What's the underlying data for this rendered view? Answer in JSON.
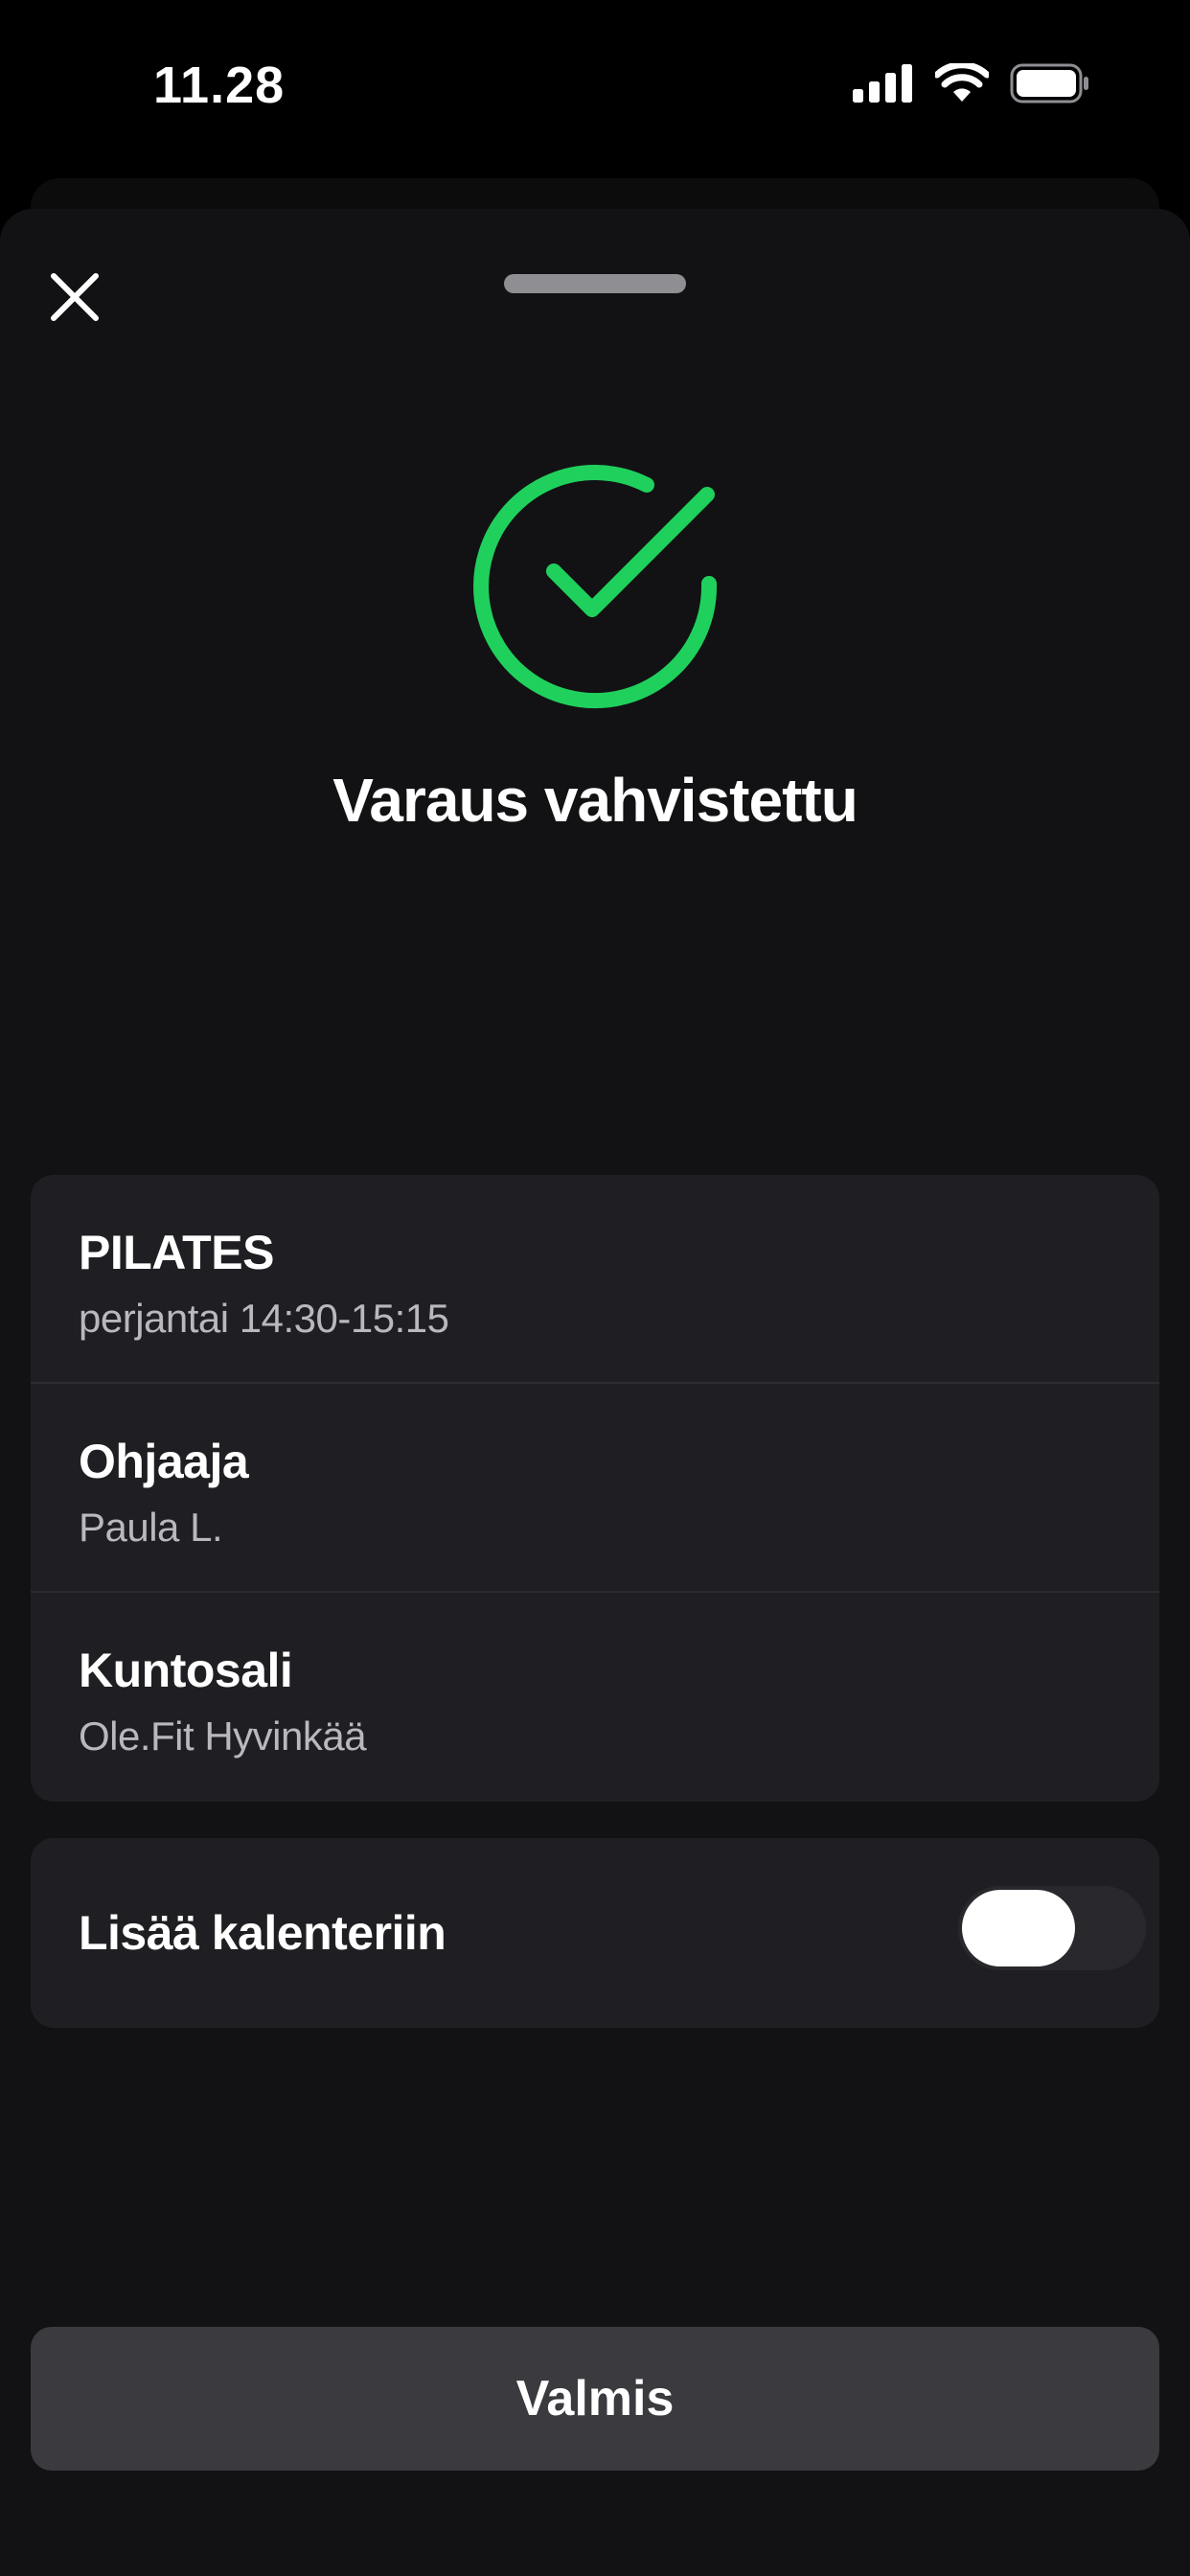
{
  "status_bar": {
    "time": "11.28",
    "icons": [
      "signal-icon",
      "wifi-icon",
      "battery-icon"
    ]
  },
  "sheet": {
    "close_icon": "close-icon",
    "title": "Varaus vahvistettu",
    "status_icon": "check-circle-icon",
    "accent_color": "#1fd15c"
  },
  "details": [
    {
      "label": "PILATES",
      "value": "perjantai 14:30-15:15"
    },
    {
      "label": "Ohjaaja",
      "value": "Paula L."
    },
    {
      "label": "Kuntosali",
      "value": "Ole.Fit Hyvinkää"
    }
  ],
  "calendar": {
    "label": "Lisää kalenteriin",
    "toggle_on": false
  },
  "done_button": {
    "label": "Valmis"
  }
}
